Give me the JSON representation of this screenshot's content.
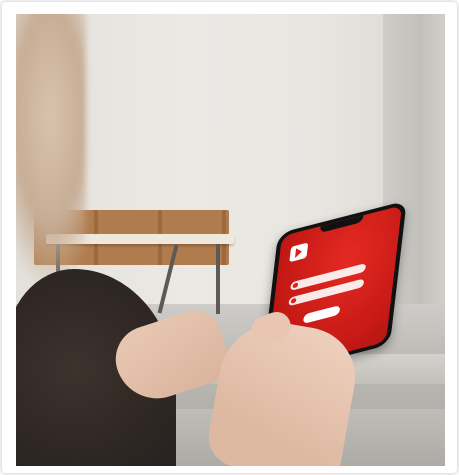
{
  "image": {
    "description_free": true,
    "frame_color": "#ffffff",
    "accent_color": "#d8221c"
  },
  "phone_app": {
    "logo_icon": "play-logo-icon",
    "title": "",
    "username_placeholder": "",
    "password_placeholder": "",
    "login_label": ""
  }
}
